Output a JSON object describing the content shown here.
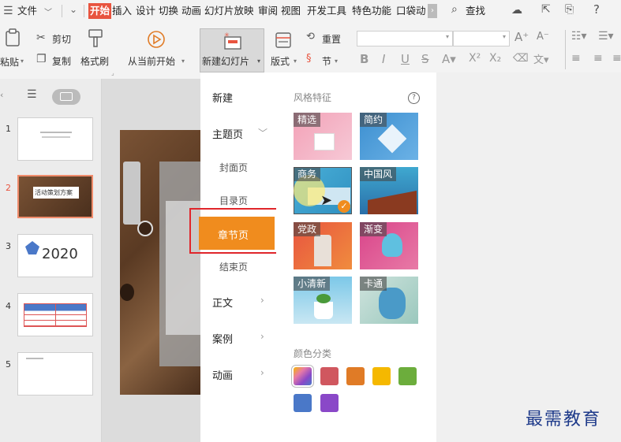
{
  "menubar": {
    "file": "文件",
    "tabs": [
      "开始",
      "插入",
      "设计",
      "切换",
      "动画",
      "幻灯片放映",
      "审阅",
      "视图",
      "开发工具",
      "特色功能",
      "口袋动"
    ],
    "search": "查找"
  },
  "ribbon": {
    "paste": "粘贴",
    "cut": "剪切",
    "copy": "复制",
    "format_painter": "格式刷",
    "play_from_current": "从当前开始",
    "new_slide": "新建幻灯片",
    "layout": "版式",
    "reset": "重置",
    "section": "节"
  },
  "slides": [
    {
      "num": "1",
      "text": ""
    },
    {
      "num": "2",
      "text": "活动策划方案"
    },
    {
      "num": "3",
      "text": "2020"
    },
    {
      "num": "4",
      "text": ""
    },
    {
      "num": "5",
      "text": ""
    }
  ],
  "menu": {
    "new": "新建",
    "theme_page": "主题页",
    "cover": "封面页",
    "toc": "目录页",
    "chapter": "章节页",
    "ending": "结束页",
    "body": "正文",
    "case": "案例",
    "animation": "动画"
  },
  "styles": {
    "heading": "风格特征",
    "cards": [
      "精选",
      "简约",
      "商务",
      "中国风",
      "党政",
      "渐变",
      "小清新",
      "卡通"
    ]
  },
  "colors": {
    "heading": "颜色分类",
    "swatches": [
      "gradient",
      "#d0575f",
      "#e07b26",
      "#f5b800",
      "#6cad3c",
      "#4a78c8",
      "#8a48c8"
    ]
  },
  "watermark": "最需教育",
  "accent": "#e8543f",
  "highlight": "#f08c1e"
}
